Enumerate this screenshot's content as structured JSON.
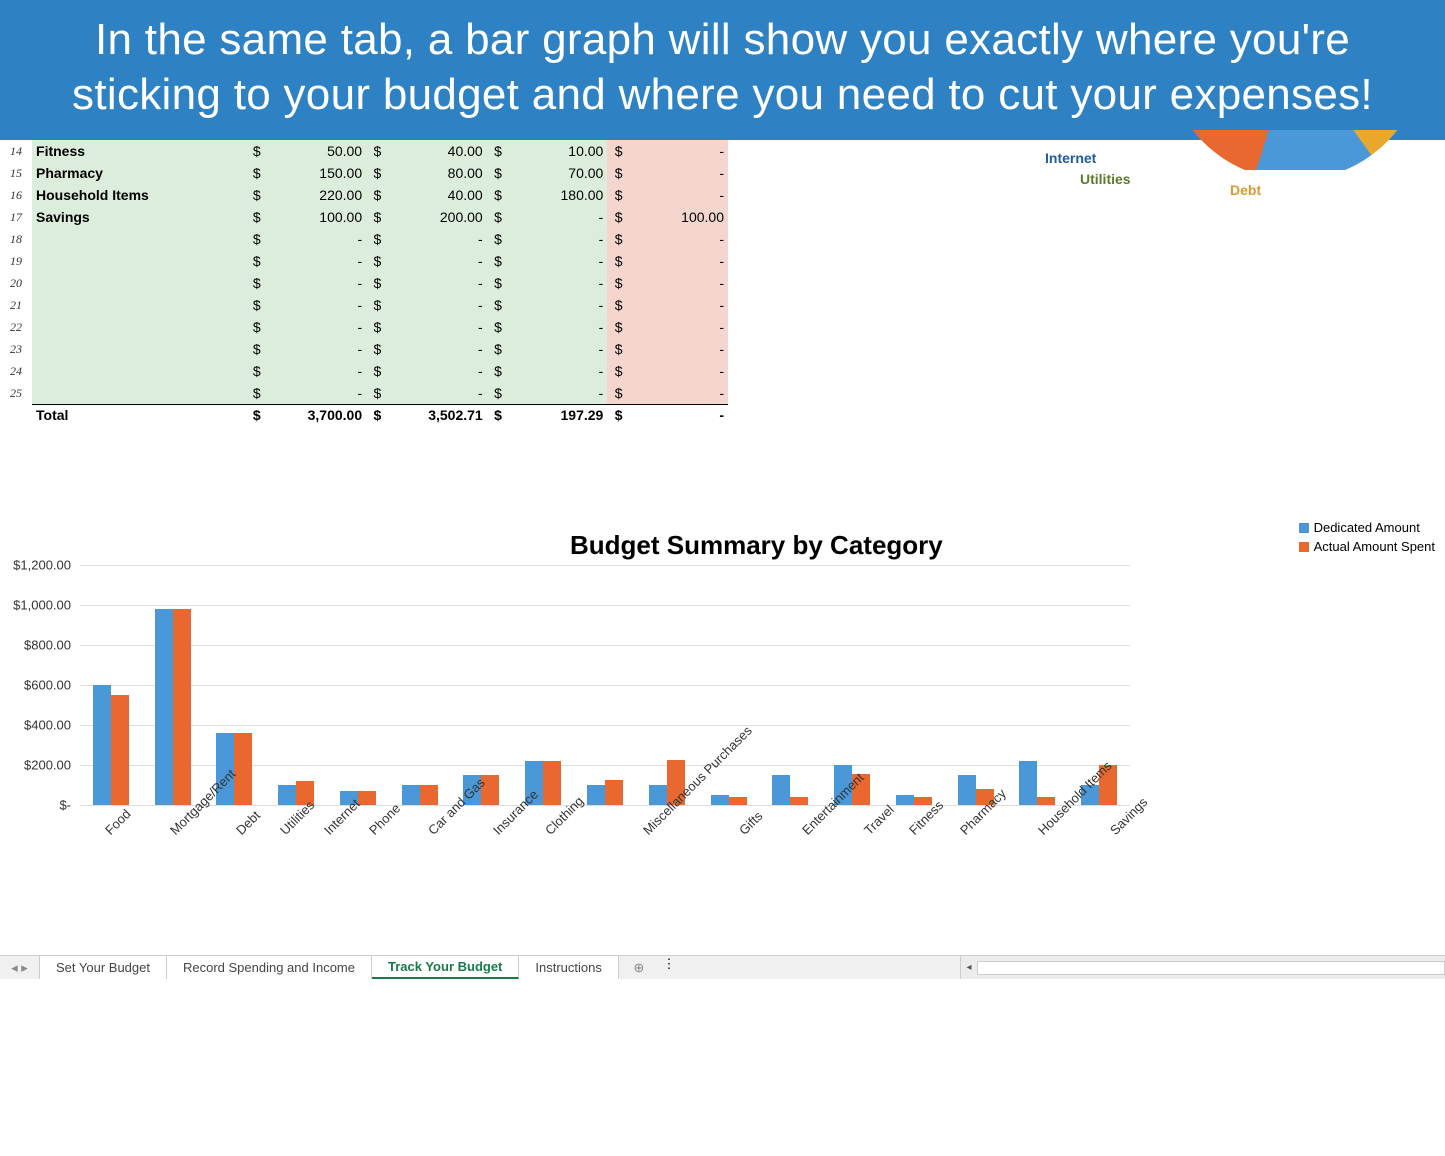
{
  "banner_text": "In the same tab, a bar graph will show you exactly where you're sticking to your budget and where you need to cut your expenses!",
  "table": {
    "rows": [
      {
        "num": "14",
        "cat": "Fitness",
        "c1": "50.00",
        "c2": "40.00",
        "c3": "10.00",
        "c4": "-"
      },
      {
        "num": "15",
        "cat": "Pharmacy",
        "c1": "150.00",
        "c2": "80.00",
        "c3": "70.00",
        "c4": "-"
      },
      {
        "num": "16",
        "cat": "Household Items",
        "c1": "220.00",
        "c2": "40.00",
        "c3": "180.00",
        "c4": "-"
      },
      {
        "num": "17",
        "cat": "Savings",
        "c1": "100.00",
        "c2": "200.00",
        "c3": "-",
        "c4": "100.00"
      },
      {
        "num": "18",
        "cat": "",
        "c1": "-",
        "c2": "-",
        "c3": "-",
        "c4": "-"
      },
      {
        "num": "19",
        "cat": "",
        "c1": "-",
        "c2": "-",
        "c3": "-",
        "c4": "-"
      },
      {
        "num": "20",
        "cat": "",
        "c1": "-",
        "c2": "-",
        "c3": "-",
        "c4": "-"
      },
      {
        "num": "21",
        "cat": "",
        "c1": "-",
        "c2": "-",
        "c3": "-",
        "c4": "-"
      },
      {
        "num": "22",
        "cat": "",
        "c1": "-",
        "c2": "-",
        "c3": "-",
        "c4": "-"
      },
      {
        "num": "23",
        "cat": "",
        "c1": "-",
        "c2": "-",
        "c3": "-",
        "c4": "-"
      },
      {
        "num": "24",
        "cat": "",
        "c1": "-",
        "c2": "-",
        "c3": "-",
        "c4": "-"
      },
      {
        "num": "25",
        "cat": "",
        "c1": "-",
        "c2": "-",
        "c3": "-",
        "c4": "-"
      }
    ],
    "total": {
      "label": "Total",
      "c1": "3,700.00",
      "c2": "3,502.71",
      "c3": "197.29",
      "c4": "-"
    }
  },
  "pie_labels": {
    "internet": "Internet",
    "utilities": "Utilities",
    "debt": "Debt"
  },
  "chart_title": "Budget Summary by Category",
  "legend": {
    "s1": "Dedicated Amount",
    "s2": "Actual Amount Spent"
  },
  "chart_data": {
    "type": "bar",
    "title": "Budget Summary by Category",
    "ylabel": "",
    "xlabel": "",
    "ylim": [
      0,
      1200
    ],
    "yticks": [
      "$-",
      "$200.00",
      "$400.00",
      "$600.00",
      "$800.00",
      "$1,000.00",
      "$1,200.00"
    ],
    "categories": [
      "Food",
      "Mortgage/Rent",
      "Debt",
      "Utilities",
      "Internet",
      "Phone",
      "Car and Gas",
      "Insurance",
      "Clothing",
      "Miscellaneous Purchases",
      "Gifts",
      "Entertainment",
      "Travel",
      "Fitness",
      "Pharmacy",
      "Household Items",
      "Savings"
    ],
    "series": [
      {
        "name": "Dedicated Amount",
        "color": "#4a98d8",
        "values": [
          600,
          980,
          360,
          100,
          70,
          100,
          150,
          220,
          100,
          100,
          50,
          150,
          200,
          50,
          150,
          220,
          100
        ]
      },
      {
        "name": "Actual Amount Spent",
        "color": "#e86830",
        "values": [
          550,
          980,
          360,
          120,
          70,
          100,
          150,
          220,
          125,
          225,
          40,
          40,
          155,
          40,
          80,
          40,
          200
        ]
      }
    ]
  },
  "tabs": {
    "items": [
      {
        "label": "Set Your Budget",
        "active": false
      },
      {
        "label": "Record Spending and Income",
        "active": false
      },
      {
        "label": "Track Your Budget",
        "active": true
      },
      {
        "label": "Instructions",
        "active": false
      }
    ]
  }
}
